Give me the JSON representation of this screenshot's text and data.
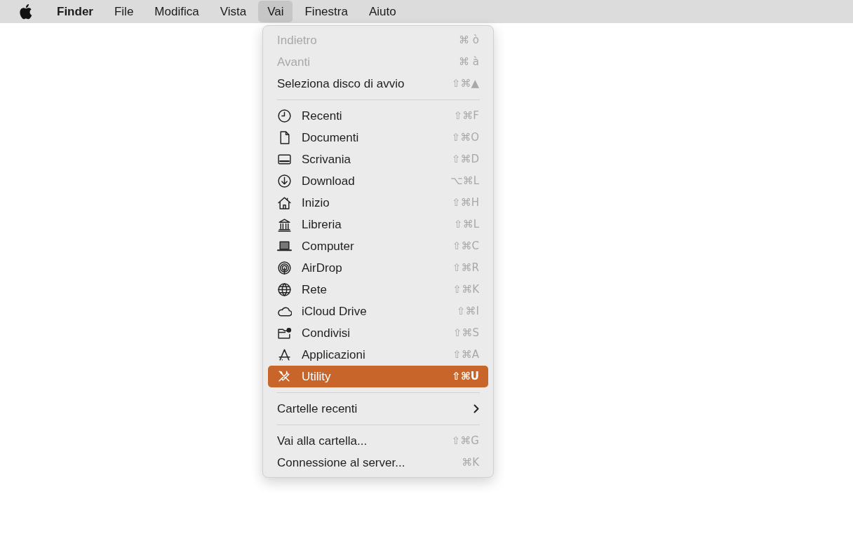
{
  "menu_bar": [
    {
      "kind": "app",
      "label": "Finder",
      "selected": false
    },
    {
      "kind": "menu",
      "label": "File",
      "selected": false
    },
    {
      "kind": "menu",
      "label": "Modifica",
      "selected": false
    },
    {
      "kind": "menu",
      "label": "Vista",
      "selected": false
    },
    {
      "kind": "menu",
      "label": "Vai",
      "selected": true
    },
    {
      "kind": "menu",
      "label": "Finestra",
      "selected": false
    },
    {
      "kind": "menu",
      "label": "Aiuto",
      "selected": false
    }
  ],
  "menu": [
    {
      "kind": "item",
      "label": "Indietro",
      "shortcut": "⌘ ò",
      "disabled": true,
      "selected": false
    },
    {
      "kind": "item",
      "label": "Avanti",
      "shortcut": "⌘ à",
      "disabled": true,
      "selected": false
    },
    {
      "kind": "item",
      "label": "Seleziona disco di avvio",
      "shortcut": "⇧⌘▲",
      "disabled": false,
      "selected": false
    },
    {
      "kind": "separator"
    },
    {
      "kind": "icon_item",
      "label": "Recenti",
      "shortcut": "⇧⌘F",
      "disabled": false,
      "selected": false
    },
    {
      "kind": "icon_item",
      "label": "Documenti",
      "shortcut": "⇧⌘O",
      "disabled": false,
      "selected": false
    },
    {
      "kind": "icon_item",
      "label": "Scrivania",
      "shortcut": "⇧⌘D",
      "disabled": false,
      "selected": false
    },
    {
      "kind": "icon_item",
      "label": "Download",
      "shortcut": "⌥⌘L",
      "disabled": false,
      "selected": false
    },
    {
      "kind": "icon_item",
      "label": "Inizio",
      "shortcut": "⇧⌘H",
      "disabled": false,
      "selected": false
    },
    {
      "kind": "icon_item",
      "label": "Libreria",
      "shortcut": "⇧⌘L",
      "disabled": false,
      "selected": false
    },
    {
      "kind": "icon_item",
      "label": "Computer",
      "shortcut": "⇧⌘C",
      "disabled": false,
      "selected": false
    },
    {
      "kind": "icon_item",
      "label": "AirDrop",
      "shortcut": "⇧⌘R",
      "disabled": false,
      "selected": false
    },
    {
      "kind": "icon_item",
      "label": "Rete",
      "shortcut": "⇧⌘K",
      "disabled": false,
      "selected": false
    },
    {
      "kind": "icon_item",
      "label": "iCloud Drive",
      "shortcut": "⇧⌘I",
      "disabled": false,
      "selected": false
    },
    {
      "kind": "icon_item",
      "label": "Condivisi",
      "shortcut": "⇧⌘S",
      "disabled": false,
      "selected": false
    },
    {
      "kind": "icon_item",
      "label": "Applicazioni",
      "shortcut": "⇧⌘A",
      "disabled": false,
      "selected": false
    },
    {
      "kind": "icon_item",
      "label": "Utility",
      "shortcut": "⇧⌘U",
      "disabled": false,
      "selected": true
    },
    {
      "kind": "separator"
    },
    {
      "kind": "submenu",
      "label": "Cartelle recenti",
      "disabled": false,
      "selected": false
    },
    {
      "kind": "separator"
    },
    {
      "kind": "item",
      "label": "Vai alla cartella...",
      "shortcut": "⇧⌘G",
      "disabled": false,
      "selected": false
    },
    {
      "kind": "item",
      "label": "Connessione al server...",
      "shortcut": "⌘K",
      "disabled": false,
      "selected": false
    }
  ]
}
